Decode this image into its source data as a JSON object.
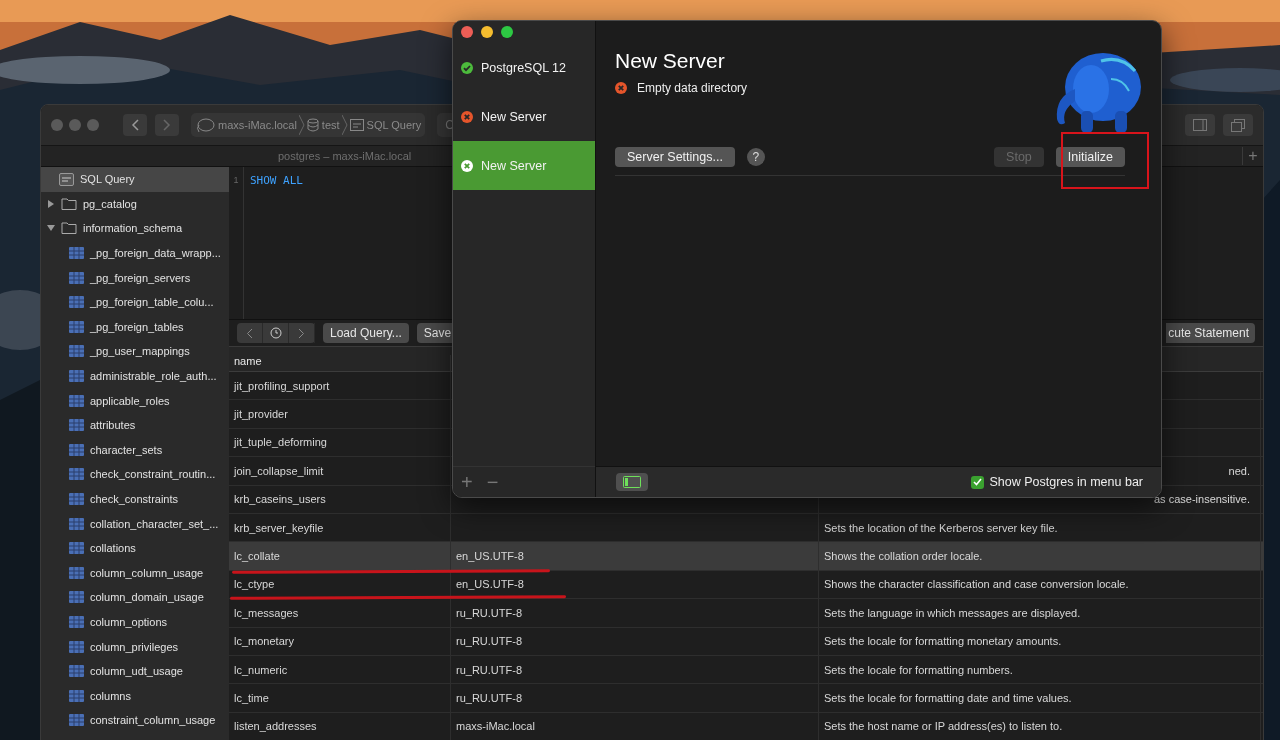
{
  "query_window": {
    "breadcrumbs": [
      "maxs-iMac.local",
      "test",
      "SQL Query"
    ],
    "toolbar_button": "C",
    "subtitle": "postgres – maxs-iMac.local",
    "new_tab": "+",
    "sidebar": {
      "items": [
        {
          "label": "SQL Query",
          "kind": "query",
          "selected": true
        },
        {
          "label": "pg_catalog",
          "kind": "schema",
          "expanded": false,
          "selected": false
        },
        {
          "label": "information_schema",
          "kind": "schema",
          "expanded": true,
          "selected": false,
          "children": [
            {
              "label": "_pg_foreign_data_wrapp...",
              "kind": "table",
              "selected": false
            },
            {
              "label": "_pg_foreign_servers",
              "kind": "table",
              "selected": false
            },
            {
              "label": "_pg_foreign_table_colu...",
              "kind": "table",
              "selected": false
            },
            {
              "label": "_pg_foreign_tables",
              "kind": "table",
              "selected": false
            },
            {
              "label": "_pg_user_mappings",
              "kind": "table",
              "selected": false
            },
            {
              "label": "administrable_role_auth...",
              "kind": "table",
              "selected": false
            },
            {
              "label": "applicable_roles",
              "kind": "table",
              "selected": false
            },
            {
              "label": "attributes",
              "kind": "table",
              "selected": false
            },
            {
              "label": "character_sets",
              "kind": "table",
              "selected": false
            },
            {
              "label": "check_constraint_routin...",
              "kind": "table",
              "selected": false
            },
            {
              "label": "check_constraints",
              "kind": "table",
              "selected": false
            },
            {
              "label": "collation_character_set_...",
              "kind": "table",
              "selected": false
            },
            {
              "label": "collations",
              "kind": "table",
              "selected": false
            },
            {
              "label": "column_column_usage",
              "kind": "table",
              "selected": false
            },
            {
              "label": "column_domain_usage",
              "kind": "table",
              "selected": false
            },
            {
              "label": "column_options",
              "kind": "table",
              "selected": false
            },
            {
              "label": "column_privileges",
              "kind": "table",
              "selected": false
            },
            {
              "label": "column_udt_usage",
              "kind": "table",
              "selected": false
            },
            {
              "label": "columns",
              "kind": "table",
              "selected": false
            },
            {
              "label": "constraint_column_usage",
              "kind": "table",
              "selected": false
            }
          ]
        }
      ]
    },
    "editor": {
      "line_numbers": [
        "1"
      ],
      "code": "SHOW ALL"
    },
    "editor_toolbar": {
      "buttons": [
        "Load Query...",
        "Save"
      ],
      "run_button": "cute Statement"
    },
    "table": {
      "columns": [
        "name"
      ],
      "rows": [
        {
          "name": "jit_profiling_support",
          "selected": false
        },
        {
          "name": "jit_provider",
          "selected": false
        },
        {
          "name": "jit_tuple_deforming",
          "selected": false
        },
        {
          "name": "join_collapse_limit",
          "description_tail": "ned.",
          "selected": false
        },
        {
          "name": "krb_caseins_users",
          "description_tail": "as case-insensitive.",
          "selected": false
        },
        {
          "name": "krb_server_keyfile",
          "description": "Sets the location of the Kerberos server key file.",
          "selected": false
        },
        {
          "name": "lc_collate",
          "setting": "en_US.UTF-8",
          "description": "Shows the collation order locale.",
          "selected": true
        },
        {
          "name": "lc_ctype",
          "setting": "en_US.UTF-8",
          "description": "Shows the character classification and case conversion locale.",
          "selected": false
        },
        {
          "name": "lc_messages",
          "setting": "ru_RU.UTF-8",
          "description": "Sets the language in which messages are displayed.",
          "selected": false
        },
        {
          "name": "lc_monetary",
          "setting": "ru_RU.UTF-8",
          "description": "Sets the locale for formatting monetary amounts.",
          "selected": false
        },
        {
          "name": "lc_numeric",
          "setting": "ru_RU.UTF-8",
          "description": "Sets the locale for formatting numbers.",
          "selected": false
        },
        {
          "name": "lc_time",
          "setting": "ru_RU.UTF-8",
          "description": "Sets the locale for formatting date and time values.",
          "selected": false
        },
        {
          "name": "listen_addresses",
          "setting": "maxs-iMac.local",
          "description": "Sets the host name or IP address(es) to listen to.",
          "selected": false
        }
      ]
    }
  },
  "server_window": {
    "servers": [
      {
        "name": "PostgreSQL 12",
        "kind": "running",
        "selected": false
      },
      {
        "name": "New Server",
        "kind": "error",
        "selected": false
      },
      {
        "name": "New Server",
        "kind": "error",
        "selected": true
      }
    ],
    "footer_buttons": [
      "+",
      "−"
    ],
    "title": "New Server",
    "status": {
      "kind": "error",
      "text": "Empty data directory"
    },
    "settings_button": "Server Settings...",
    "help_button": "?",
    "stop_button": {
      "label": "Stop",
      "disabled": true
    },
    "initialize_button": {
      "label": "Initialize",
      "disabled": false
    },
    "menu_bar_option": {
      "label": "Show Postgres in menu bar",
      "checked": true
    }
  }
}
